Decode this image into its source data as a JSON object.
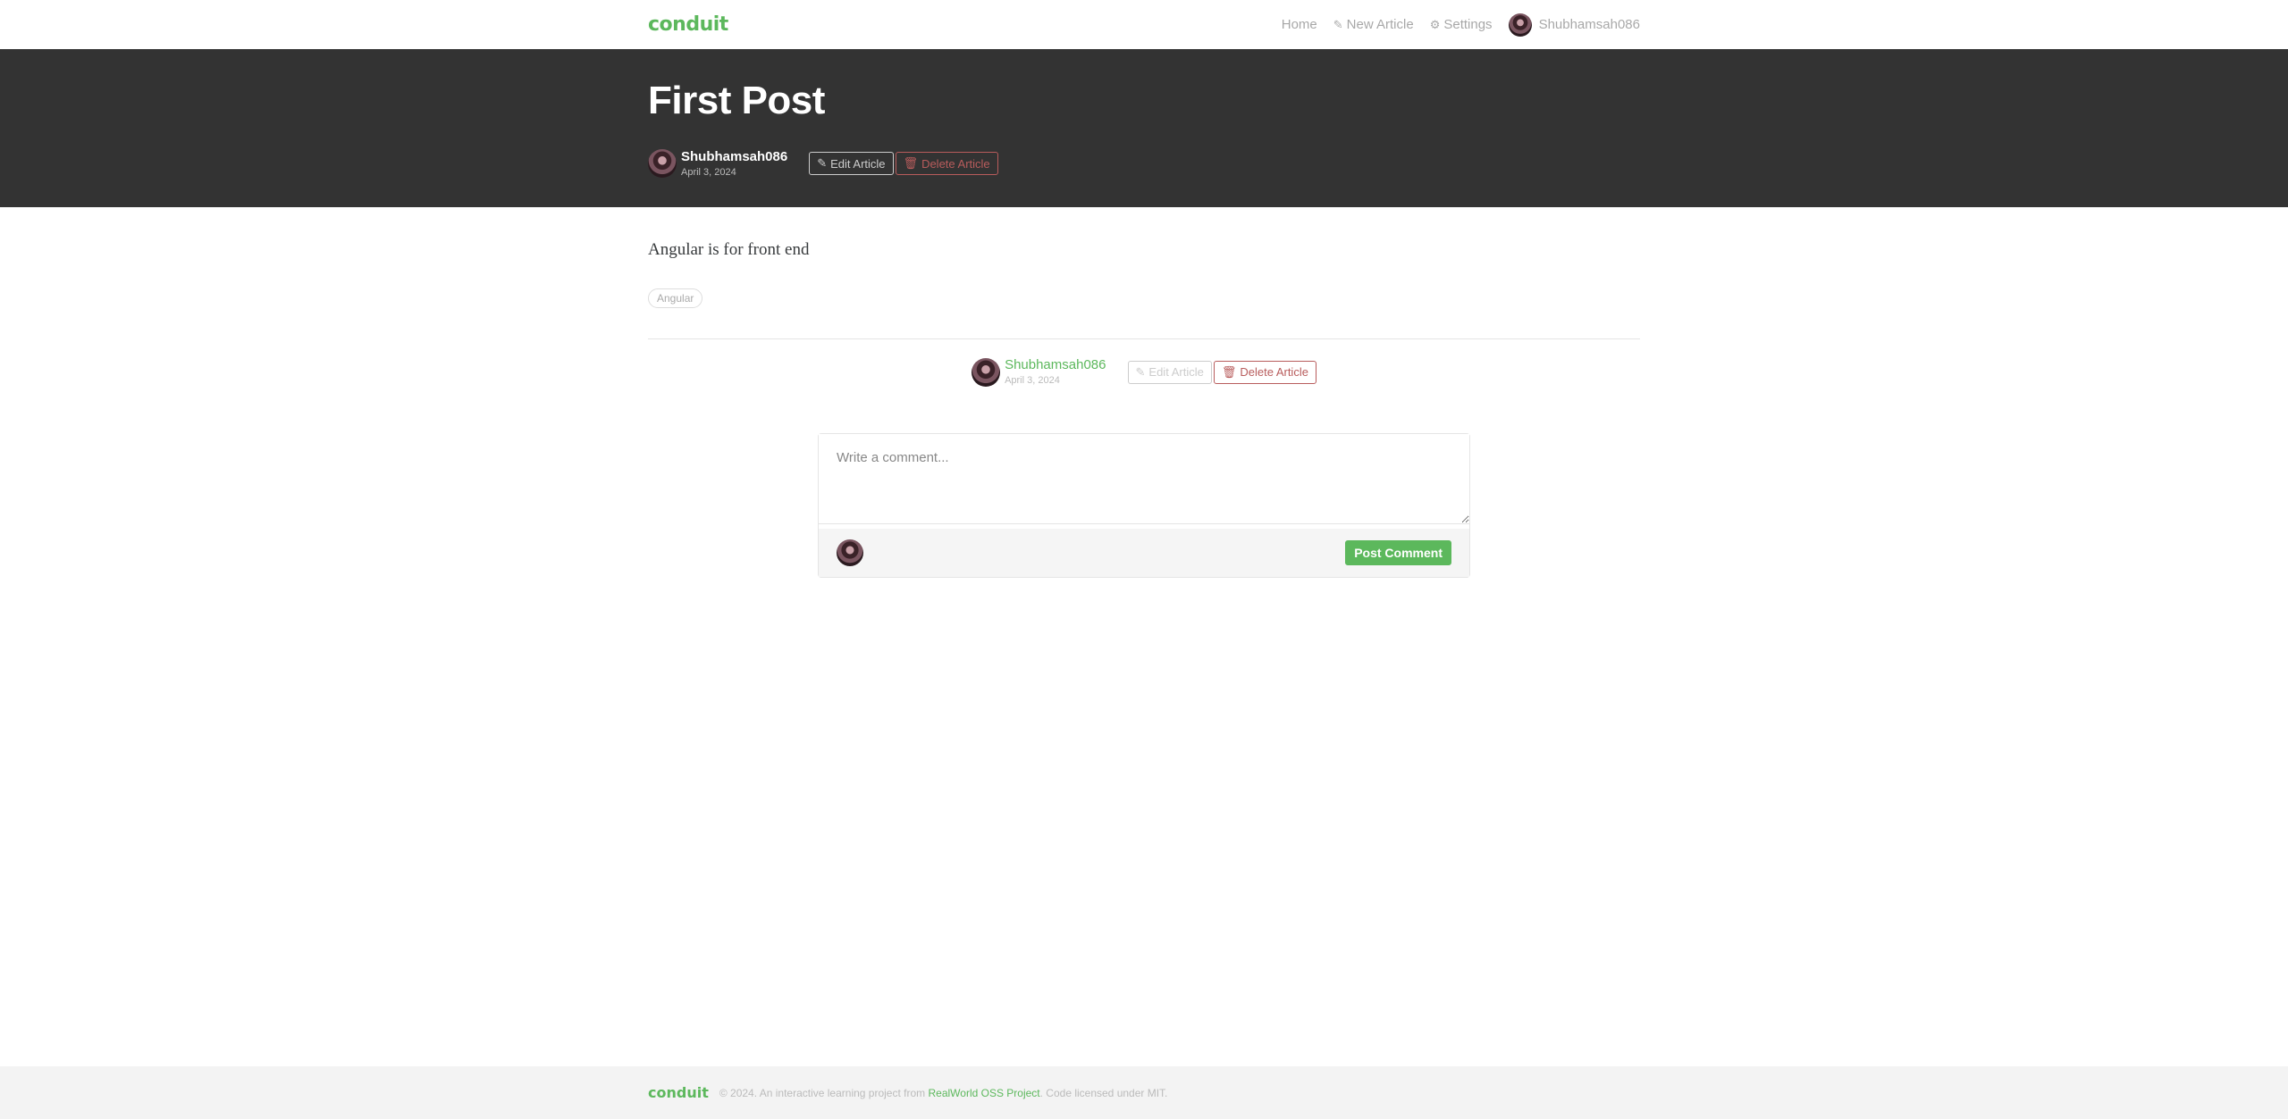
{
  "navbar": {
    "brand": "conduit",
    "home": "Home",
    "new_article": "New Article",
    "settings": "Settings",
    "username": "Shubhamsah086"
  },
  "article": {
    "title": "First Post",
    "author": "Shubhamsah086",
    "date": "April 3, 2024",
    "body": "Angular is for front end",
    "tags": [
      "Angular"
    ],
    "edit_label": "Edit Article",
    "delete_label": "Delete Article"
  },
  "comment_form": {
    "placeholder": "Write a comment...",
    "post_label": "Post Comment"
  },
  "footer": {
    "brand": "conduit",
    "text_before": "© 2024. An interactive learning project from",
    "link": "RealWorld OSS Project",
    "text_after": ". Code licensed under MIT."
  },
  "colors": {
    "accent": "#5cb85c",
    "banner": "#333333",
    "danger": "#b85c5c"
  },
  "icons": {
    "new_article": "edit-icon",
    "settings": "gear-icon",
    "edit": "pencil-icon",
    "delete": "trash-icon"
  }
}
